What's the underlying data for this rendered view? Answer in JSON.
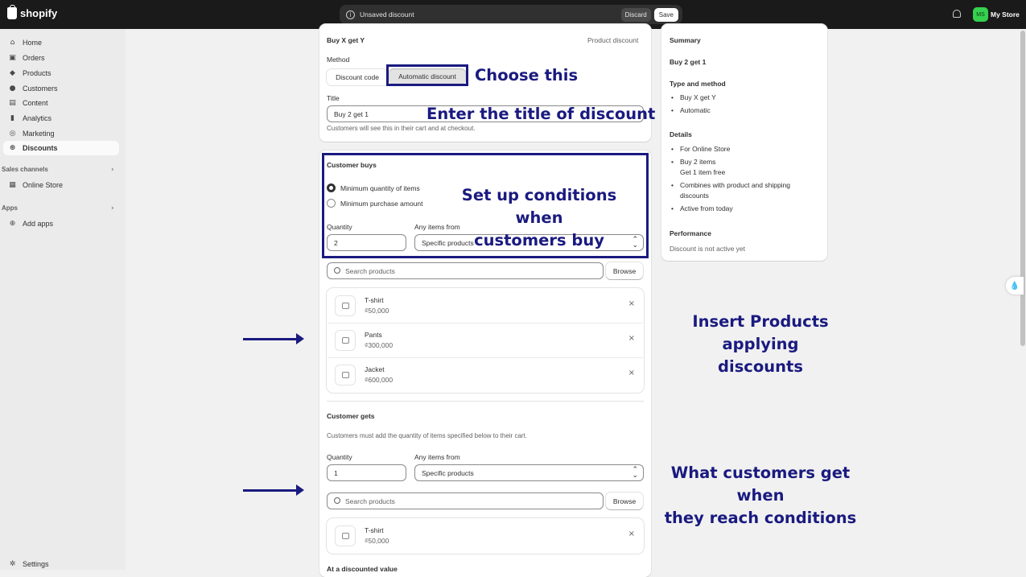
{
  "topbar": {
    "brand": "shopify",
    "status": "Unsaved discount",
    "discard_label": "Discard",
    "save_label": "Save",
    "avatar_initials": "MS",
    "store_name": "My Store"
  },
  "sidebar": {
    "items": [
      {
        "label": "Home",
        "icon": "home-icon"
      },
      {
        "label": "Orders",
        "icon": "inbox-icon"
      },
      {
        "label": "Products",
        "icon": "tag-icon"
      },
      {
        "label": "Customers",
        "icon": "person-icon"
      },
      {
        "label": "Content",
        "icon": "image-icon"
      },
      {
        "label": "Analytics",
        "icon": "chart-icon"
      },
      {
        "label": "Marketing",
        "icon": "target-icon"
      },
      {
        "label": "Discounts",
        "icon": "discount-icon"
      }
    ],
    "sales_channels": "Sales channels",
    "online_store": "Online Store",
    "apps": "Apps",
    "add_apps": "Add apps",
    "settings": "Settings"
  },
  "discount": {
    "heading": "Buy X get Y",
    "type": "Product discount",
    "method_label": "Method",
    "method_code": "Discount code",
    "method_auto": "Automatic discount",
    "title_label": "Title",
    "title_value": "Buy 2 get 1",
    "title_help": "Customers will see this in their cart and at checkout."
  },
  "customer_buys": {
    "heading": "Customer buys",
    "option_min_qty": "Minimum quantity of items",
    "option_min_amount": "Minimum purchase amount",
    "quantity_label": "Quantity",
    "quantity_value": "2",
    "items_from_label": "Any items from",
    "items_from_value": "Specific products",
    "search_placeholder": "Search products",
    "browse_label": "Browse",
    "products": [
      {
        "name": "T-shirt",
        "price": "₫50,000"
      },
      {
        "name": "Pants",
        "price": "₫300,000"
      },
      {
        "name": "Jacket",
        "price": "₫600,000"
      }
    ]
  },
  "customer_gets": {
    "heading": "Customer gets",
    "help": "Customers must add the quantity of items specified below to their cart.",
    "quantity_label": "Quantity",
    "quantity_value": "1",
    "items_from_label": "Any items from",
    "items_from_value": "Specific products",
    "search_placeholder": "Search products",
    "browse_label": "Browse",
    "products": [
      {
        "name": "T-shirt",
        "price": "₫50,000"
      }
    ],
    "next_heading": "At a discounted value"
  },
  "summary": {
    "heading": "Summary",
    "title": "Buy 2 get 1",
    "type_heading": "Type and method",
    "type_items": [
      "Buy X get Y",
      "Automatic"
    ],
    "details_heading": "Details",
    "details_items": [
      "For Online Store",
      "Buy 2 items",
      "Get 1 item free",
      "Combines with product and shipping",
      "discounts",
      "Active from today"
    ],
    "performance_heading": "Performance",
    "performance_text": "Discount is not active yet"
  },
  "annotations": {
    "choose": "Choose this",
    "title": "Enter the title of discount",
    "conditions_line1": "Set up conditions when",
    "conditions_line2": "customers buy",
    "products_line1": "Insert Products applying",
    "products_line2": "discounts",
    "gets_line1": "What customers get when",
    "gets_line2": "they reach conditions"
  },
  "colors": {
    "annotation": "#1a1a80",
    "topbar": "#1a1a1a",
    "avatar": "#35d14f"
  }
}
